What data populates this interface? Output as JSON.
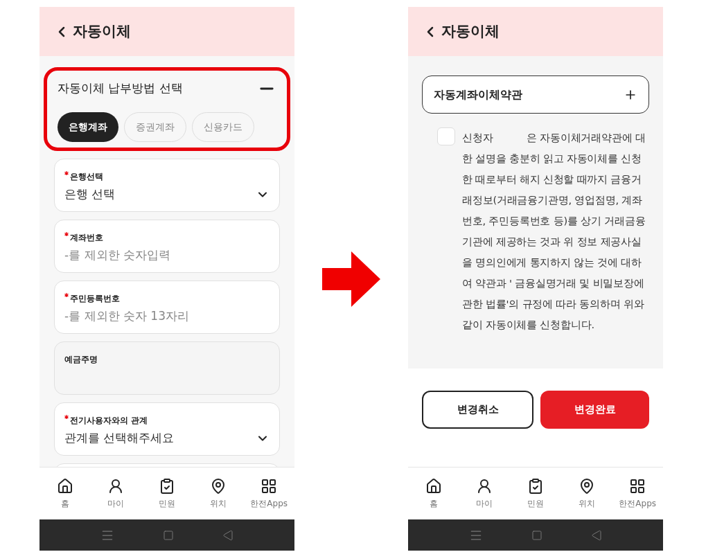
{
  "screens": [
    {
      "kind": "form",
      "title": "자동이체",
      "payment_method": {
        "title": "자동이체 납부방법 선택",
        "expanded": true,
        "highlighted": true,
        "options": [
          {
            "label": "은행계좌",
            "selected": true
          },
          {
            "label": "증권계좌",
            "selected": false
          },
          {
            "label": "신용카드",
            "selected": false
          }
        ]
      },
      "fields": [
        {
          "kind": "select",
          "label": "은행선택",
          "required": true,
          "disabled": false,
          "value": "은행 선택"
        },
        {
          "kind": "input",
          "label": "계좌번호",
          "required": true,
          "disabled": false,
          "placeholder": "-를 제외한 숫자입력"
        },
        {
          "kind": "input",
          "label": "주민등록번호",
          "required": true,
          "disabled": false,
          "placeholder": "-를 제외한 숫자 13자리"
        },
        {
          "kind": "input",
          "label": "예금주명",
          "required": false,
          "disabled": true
        },
        {
          "kind": "select",
          "label": "전기사용자와의 관계",
          "required": true,
          "disabled": false,
          "value": "관계를 선택해주세요"
        }
      ],
      "nav": [
        {
          "label": "홈"
        },
        {
          "label": "마이"
        },
        {
          "label": "민원"
        },
        {
          "label": "위치"
        },
        {
          "label": "한전Apps"
        }
      ]
    },
    {
      "kind": "terms",
      "title": "자동이체",
      "terms": {
        "title": "자동계좌이체약관",
        "expanded": false
      },
      "agreement": {
        "checked": false,
        "text": "신청자           은 자동이체거래약관에 대한 설명을 충분히 읽고 자동이체를 신청한 때로부터 해지 신청할 때까지 금융거래정보(거래금융기관명, 영업점명, 계좌번호, 주민등록번호 등)를 상기 거래금융기관에 제공하는 것과 위 정보 제공사실을 명의인에게 통지하지 않는 것에 대하여 약관과 ' 금융실명거래 및 비밀보장에 관한 법률'의 규정에 따라 동의하며 위와 같이 자동이체를 신청합니다."
      },
      "buttons": [
        {
          "label": "변경취소",
          "kind": "secondary"
        },
        {
          "label": "변경완료",
          "kind": "primary"
        }
      ],
      "nav": [
        {
          "label": "홈"
        },
        {
          "label": "마이"
        },
        {
          "label": "민원"
        },
        {
          "label": "위치"
        },
        {
          "label": "한전Apps"
        }
      ]
    }
  ]
}
